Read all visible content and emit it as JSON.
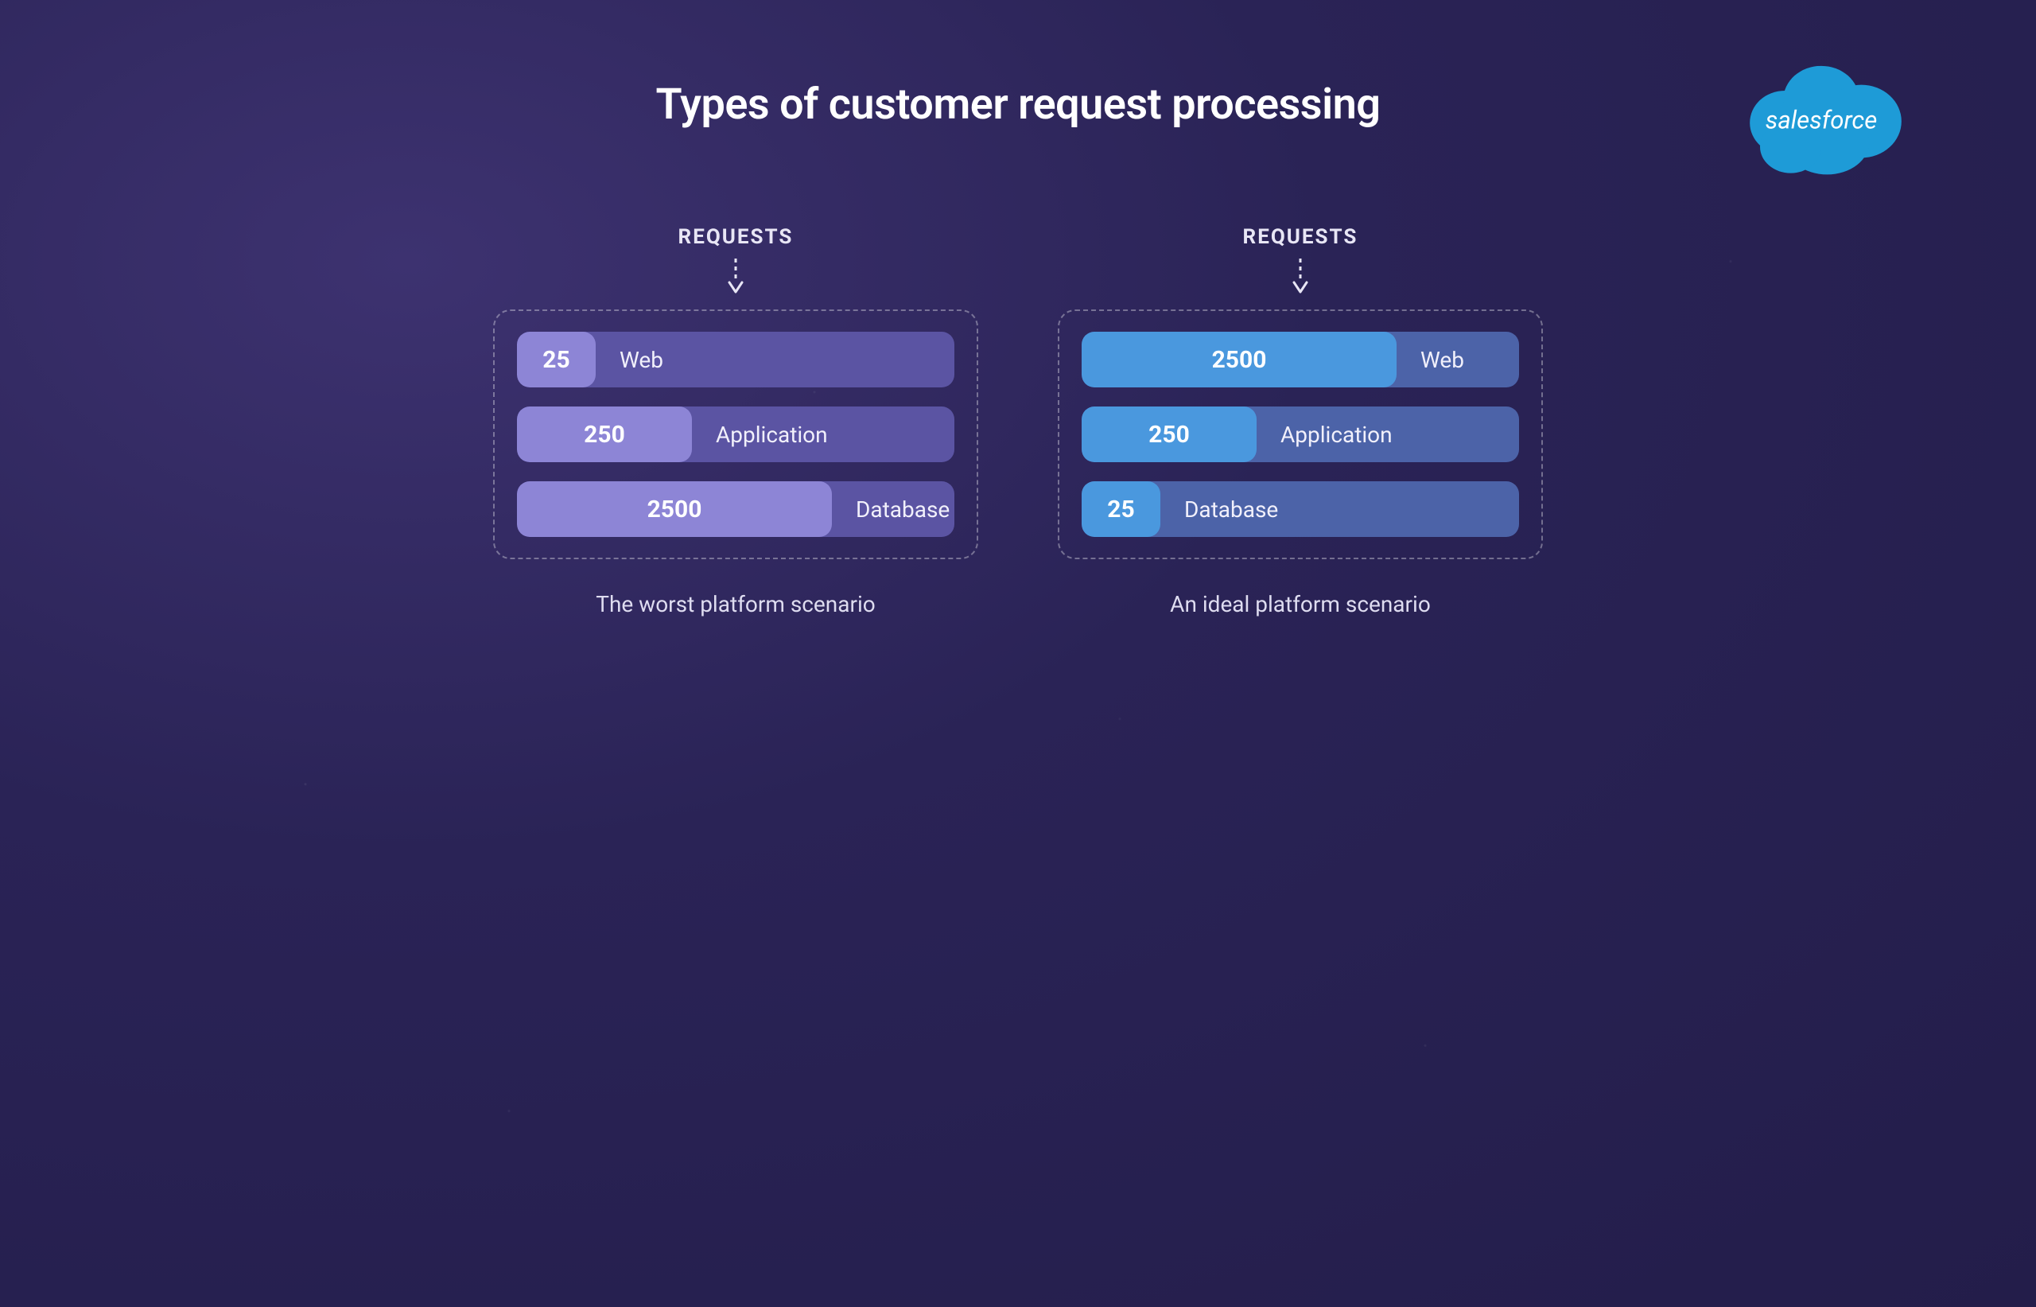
{
  "title": "Types of customer request processing",
  "logo": {
    "name": "salesforce",
    "text": "salesforce",
    "color": "#1e9bd7"
  },
  "requests_label": "REQUESTS",
  "scenarios": {
    "worst": {
      "caption": "The worst platform scenario",
      "bars": [
        {
          "value": "25",
          "label": "Web",
          "width": "wS"
        },
        {
          "value": "250",
          "label": "Application",
          "width": "wM"
        },
        {
          "value": "2500",
          "label": "Database",
          "width": "wL"
        }
      ]
    },
    "ideal": {
      "caption": "An ideal platform scenario",
      "bars": [
        {
          "value": "2500",
          "label": "Web",
          "width": "wL"
        },
        {
          "value": "250",
          "label": "Application",
          "width": "wM"
        },
        {
          "value": "25",
          "label": "Database",
          "width": "wS"
        }
      ]
    }
  }
}
